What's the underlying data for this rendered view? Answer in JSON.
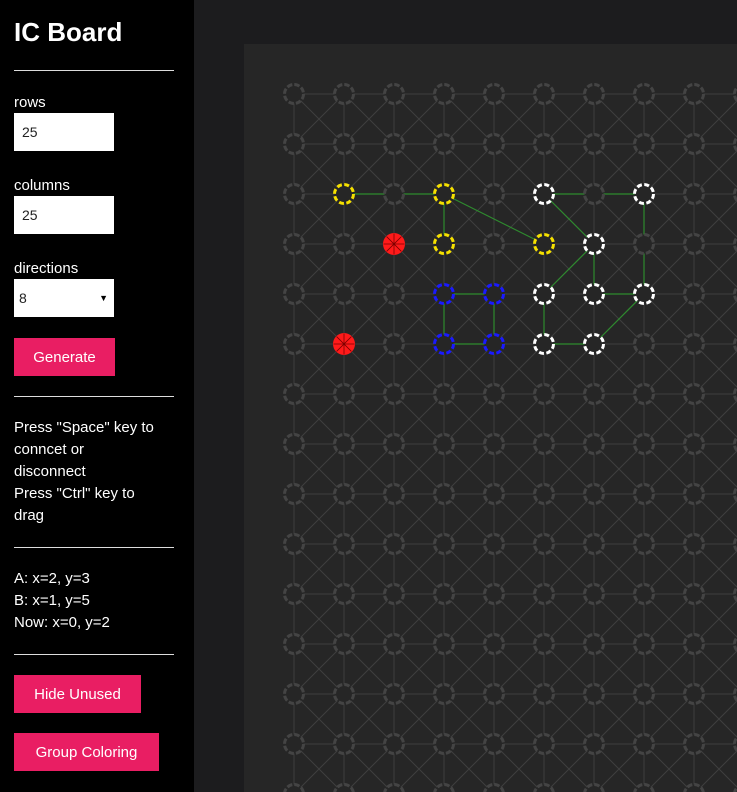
{
  "sidebar": {
    "title": "IC Board",
    "rows_label": "rows",
    "rows_value": "25",
    "columns_label": "columns",
    "columns_value": "25",
    "directions_label": "directions",
    "directions_value": "8",
    "generate_label": "Generate",
    "instructions": [
      "Press \"Space\" key to",
      "conncet or",
      "disconnect",
      "Press \"Ctrl\" key to",
      "drag"
    ],
    "status": {
      "a": "A: x=2, y=3",
      "b": "B: x=1, y=5",
      "now": "Now: x=0, y=2"
    },
    "hide_unused_label": "Hide Unused",
    "group_coloring_label": "Group Coloring"
  },
  "board": {
    "rows": 25,
    "columns": 25,
    "directions": 8,
    "colors": {
      "background": "#262626",
      "grid_line": "#3f3f3f",
      "unused_node": "#444444",
      "connection": "#2e8b2e",
      "yellow": "#f5e000",
      "white": "#ffffff",
      "blue": "#1a1aff",
      "red": "#ff1a1a"
    },
    "colored_nodes": [
      {
        "x": 1,
        "y": 2,
        "color": "yellow"
      },
      {
        "x": 3,
        "y": 2,
        "color": "yellow"
      },
      {
        "x": 3,
        "y": 3,
        "color": "yellow"
      },
      {
        "x": 5,
        "y": 3,
        "color": "yellow"
      },
      {
        "x": 2,
        "y": 3,
        "color": "red"
      },
      {
        "x": 1,
        "y": 5,
        "color": "red"
      },
      {
        "x": 3,
        "y": 4,
        "color": "blue"
      },
      {
        "x": 4,
        "y": 4,
        "color": "blue"
      },
      {
        "x": 3,
        "y": 5,
        "color": "blue"
      },
      {
        "x": 4,
        "y": 5,
        "color": "blue"
      },
      {
        "x": 5,
        "y": 2,
        "color": "white"
      },
      {
        "x": 7,
        "y": 2,
        "color": "white"
      },
      {
        "x": 6,
        "y": 3,
        "color": "white"
      },
      {
        "x": 5,
        "y": 4,
        "color": "white"
      },
      {
        "x": 6,
        "y": 4,
        "color": "white"
      },
      {
        "x": 7,
        "y": 4,
        "color": "white"
      },
      {
        "x": 5,
        "y": 5,
        "color": "white"
      },
      {
        "x": 6,
        "y": 5,
        "color": "white"
      }
    ],
    "connections": [
      [
        [
          1,
          2
        ],
        [
          3,
          2
        ]
      ],
      [
        [
          3,
          2
        ],
        [
          3,
          3
        ]
      ],
      [
        [
          3,
          2
        ],
        [
          5,
          3
        ]
      ],
      [
        [
          5,
          2
        ],
        [
          7,
          2
        ]
      ],
      [
        [
          5,
          2
        ],
        [
          6,
          3
        ]
      ],
      [
        [
          7,
          2
        ],
        [
          7,
          4
        ]
      ],
      [
        [
          6,
          3
        ],
        [
          6,
          4
        ]
      ],
      [
        [
          6,
          3
        ],
        [
          5,
          4
        ]
      ],
      [
        [
          6,
          4
        ],
        [
          7,
          4
        ]
      ],
      [
        [
          7,
          4
        ],
        [
          6,
          5
        ]
      ],
      [
        [
          5,
          4
        ],
        [
          5,
          5
        ]
      ],
      [
        [
          5,
          5
        ],
        [
          6,
          5
        ]
      ],
      [
        [
          3,
          4
        ],
        [
          4,
          4
        ]
      ],
      [
        [
          4,
          4
        ],
        [
          4,
          5
        ]
      ],
      [
        [
          3,
          4
        ],
        [
          3,
          5
        ]
      ],
      [
        [
          3,
          5
        ],
        [
          4,
          5
        ]
      ]
    ]
  }
}
